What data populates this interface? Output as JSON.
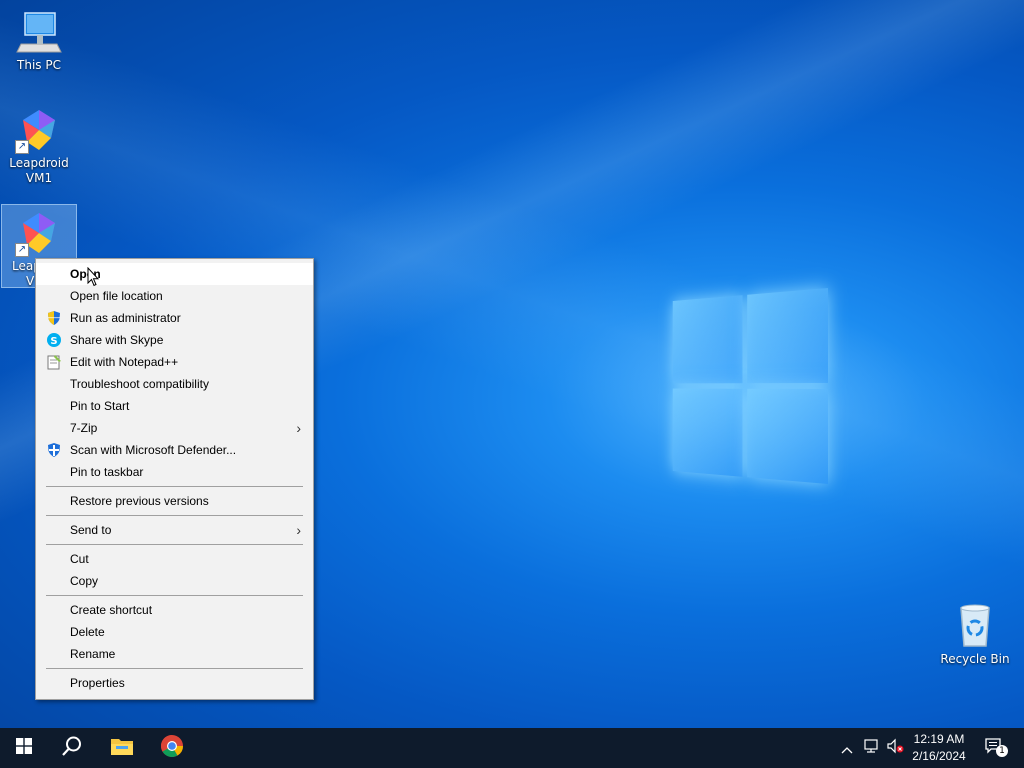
{
  "desktop": {
    "icons": [
      {
        "label": "This PC",
        "icon": "this-pc-icon"
      },
      {
        "label": "Leapdroid\nVM1",
        "label_line1": "Leapdroid",
        "label_line2": "VM1",
        "icon": "leapdroid-icon"
      },
      {
        "label_line1": "Leap",
        "label_line2": "V",
        "icon": "leapdroid-icon",
        "selected": true
      },
      {
        "label": "Recycle Bin",
        "icon": "recycle-bin-icon"
      }
    ]
  },
  "context_menu": {
    "items": [
      {
        "label": "Open",
        "bold": true
      },
      {
        "label": "Open file location"
      },
      {
        "label": "Run as administrator",
        "icon": "shield-icon"
      },
      {
        "label": "Share with Skype",
        "icon": "skype-icon"
      },
      {
        "label": "Edit with Notepad++",
        "icon": "notepad-plus-plus-icon"
      },
      {
        "label": "Troubleshoot compatibility"
      },
      {
        "label": "Pin to Start"
      },
      {
        "label": "7-Zip",
        "submenu": true
      },
      {
        "label": "Scan with Microsoft Defender...",
        "icon": "defender-icon"
      },
      {
        "label": "Pin to taskbar"
      },
      {
        "label": "Restore previous versions"
      },
      {
        "label": "Send to",
        "submenu": true
      },
      {
        "label": "Cut"
      },
      {
        "label": "Copy"
      },
      {
        "label": "Create shortcut"
      },
      {
        "label": "Delete"
      },
      {
        "label": "Rename"
      },
      {
        "label": "Properties"
      }
    ]
  },
  "taskbar": {
    "buttons": [
      "start-icon",
      "search-icon",
      "file-explorer-icon",
      "chrome-icon"
    ],
    "tray": {
      "icons": [
        "chevron-up-icon",
        "network-icon",
        "volume-muted-icon"
      ],
      "time": "12:19 AM",
      "date": "2/16/2024",
      "notification_count": "1"
    }
  },
  "colors": {
    "desktop_blue": "#0a6fdc",
    "menu_bg": "#f2f2f2",
    "taskbar_bg": "#0e1b2c"
  }
}
